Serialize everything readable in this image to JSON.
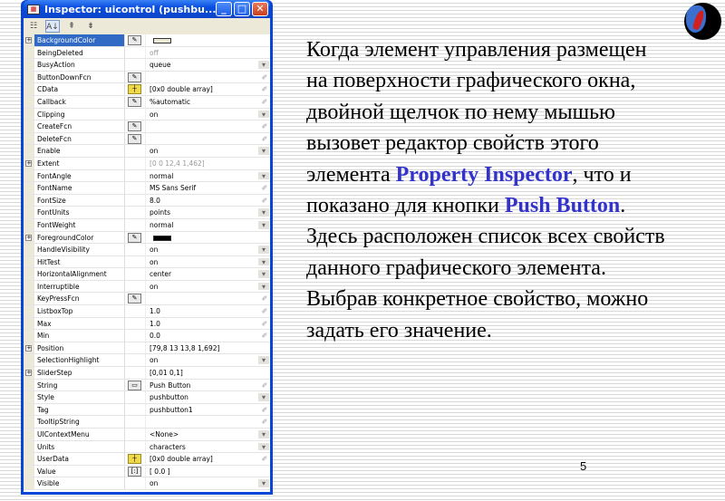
{
  "window": {
    "title": "Inspector:  uicontrol (pushbu...",
    "min": "_",
    "max": "□",
    "close": "✕"
  },
  "toolbar": {
    "categorized": "☷",
    "alpha": "A↓",
    "expand": "⇞",
    "collapse": "⇟"
  },
  "properties": [
    {
      "name": "BackgroundColor",
      "icon": "color",
      "value": "",
      "swatch": "#ece9d8",
      "control": "",
      "expand": true,
      "selected": true
    },
    {
      "name": "BeingDeleted",
      "icon": "",
      "value": "off",
      "control": "",
      "grey": true
    },
    {
      "name": "BusyAction",
      "icon": "",
      "value": "queue",
      "control": "dropdown"
    },
    {
      "name": "ButtonDownFcn",
      "icon": "callback",
      "value": "",
      "control": "edit"
    },
    {
      "name": "CData",
      "icon": "array",
      "value": "[0x0  double array]",
      "control": "edit"
    },
    {
      "name": "Callback",
      "icon": "callback",
      "value": "%automatic",
      "control": "edit"
    },
    {
      "name": "Clipping",
      "icon": "",
      "value": "on",
      "control": "dropdown"
    },
    {
      "name": "CreateFcn",
      "icon": "callback",
      "value": "",
      "control": "edit"
    },
    {
      "name": "DeleteFcn",
      "icon": "callback",
      "value": "",
      "control": "edit"
    },
    {
      "name": "Enable",
      "icon": "",
      "value": "on",
      "control": "dropdown"
    },
    {
      "name": "Extent",
      "icon": "",
      "value": "[0 0 12,4 1,462]",
      "control": "",
      "expand": true,
      "grey": true
    },
    {
      "name": "FontAngle",
      "icon": "",
      "value": "normal",
      "control": "dropdown"
    },
    {
      "name": "FontName",
      "icon": "",
      "value": "MS Sans Serif",
      "control": "edit"
    },
    {
      "name": "FontSize",
      "icon": "",
      "value": "8.0",
      "control": "edit"
    },
    {
      "name": "FontUnits",
      "icon": "",
      "value": "points",
      "control": "dropdown"
    },
    {
      "name": "FontWeight",
      "icon": "",
      "value": "normal",
      "control": "dropdown"
    },
    {
      "name": "ForegroundColor",
      "icon": "color",
      "value": "",
      "swatch": "#000000",
      "control": "",
      "expand": true
    },
    {
      "name": "HandleVisibility",
      "icon": "",
      "value": "on",
      "control": "dropdown"
    },
    {
      "name": "HitTest",
      "icon": "",
      "value": "on",
      "control": "dropdown"
    },
    {
      "name": "HorizontalAlignment",
      "icon": "",
      "value": "center",
      "control": "dropdown"
    },
    {
      "name": "Interruptible",
      "icon": "",
      "value": "on",
      "control": "dropdown"
    },
    {
      "name": "KeyPressFcn",
      "icon": "callback",
      "value": "",
      "control": "edit"
    },
    {
      "name": "ListboxTop",
      "icon": "",
      "value": "1.0",
      "control": "edit"
    },
    {
      "name": "Max",
      "icon": "",
      "value": "1.0",
      "control": "edit"
    },
    {
      "name": "Min",
      "icon": "",
      "value": "0.0",
      "control": "edit"
    },
    {
      "name": "Position",
      "icon": "",
      "value": "[79,8 13 13,8 1,692]",
      "control": "",
      "expand": true
    },
    {
      "name": "SelectionHighlight",
      "icon": "",
      "value": "on",
      "control": "dropdown"
    },
    {
      "name": "SliderStep",
      "icon": "",
      "value": "[0,01 0,1]",
      "control": "",
      "expand": true
    },
    {
      "name": "String",
      "icon": "string",
      "value": "Push Button",
      "control": "edit"
    },
    {
      "name": "Style",
      "icon": "",
      "value": "pushbutton",
      "control": "dropdown"
    },
    {
      "name": "Tag",
      "icon": "",
      "value": "pushbutton1",
      "control": "edit"
    },
    {
      "name": "TooltipString",
      "icon": "",
      "value": "",
      "control": "edit"
    },
    {
      "name": "UIContextMenu",
      "icon": "",
      "value": "<None>",
      "control": "dropdown"
    },
    {
      "name": "Units",
      "icon": "",
      "value": "characters",
      "control": "dropdown"
    },
    {
      "name": "UserData",
      "icon": "array",
      "value": "[0x0  double array]",
      "control": "edit"
    },
    {
      "name": "Value",
      "icon": "matrix",
      "value": "[ 0.0 ]",
      "control": ""
    },
    {
      "name": "Visible",
      "icon": "",
      "value": "on",
      "control": "dropdown"
    }
  ],
  "slide": {
    "t1": "Когда элемент управления размещен на поверхности графического окна,  двойной щелчок по нему мышью вызовет редактор свойств этого элемента ",
    "b1": "Property Inspector",
    "t2": ", что и показано для кнопки ",
    "b2": "Push Button",
    "t3": ".",
    "t4": "Здесь расположен список  всех свойств данного графического элемента. Выбрав конкретное свойство, можно задать его значение.",
    "page": "5"
  },
  "colors": {
    "accent": "#3333cc",
    "title_bar": "#0a4ee0"
  }
}
